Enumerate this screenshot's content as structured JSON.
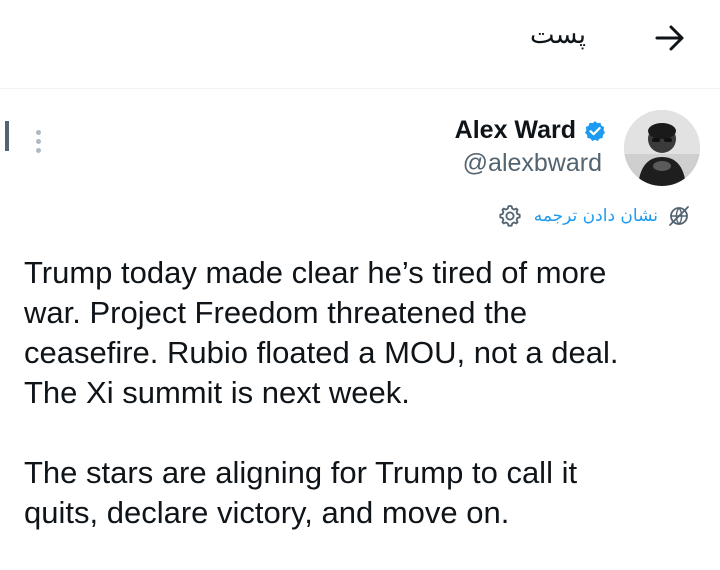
{
  "header": {
    "title": "پست"
  },
  "author": {
    "name": "Alex Ward",
    "handle": "@alexbward"
  },
  "translate": {
    "label": "نشان دادن ترجمه"
  },
  "tweet": {
    "paragraphs": [
      "Trump today made clear he’s tired of more\nwar. Project Freedom threatened the\nceasefire. Rubio floated a MOU, not a deal.\nThe Xi summit is next week.",
      "The stars are aligning for Trump to call it\nquits, declare victory, and move on."
    ]
  },
  "colors": {
    "accent": "#1d9bf0",
    "text_primary": "#0f1419",
    "text_secondary": "#536471",
    "verified": "#1d9bf0"
  },
  "icons": {
    "back": "arrow-right-icon",
    "more": "more-vertical-icon",
    "verified": "verified-badge-icon",
    "settings": "gear-icon",
    "translate": "globe-icon"
  }
}
